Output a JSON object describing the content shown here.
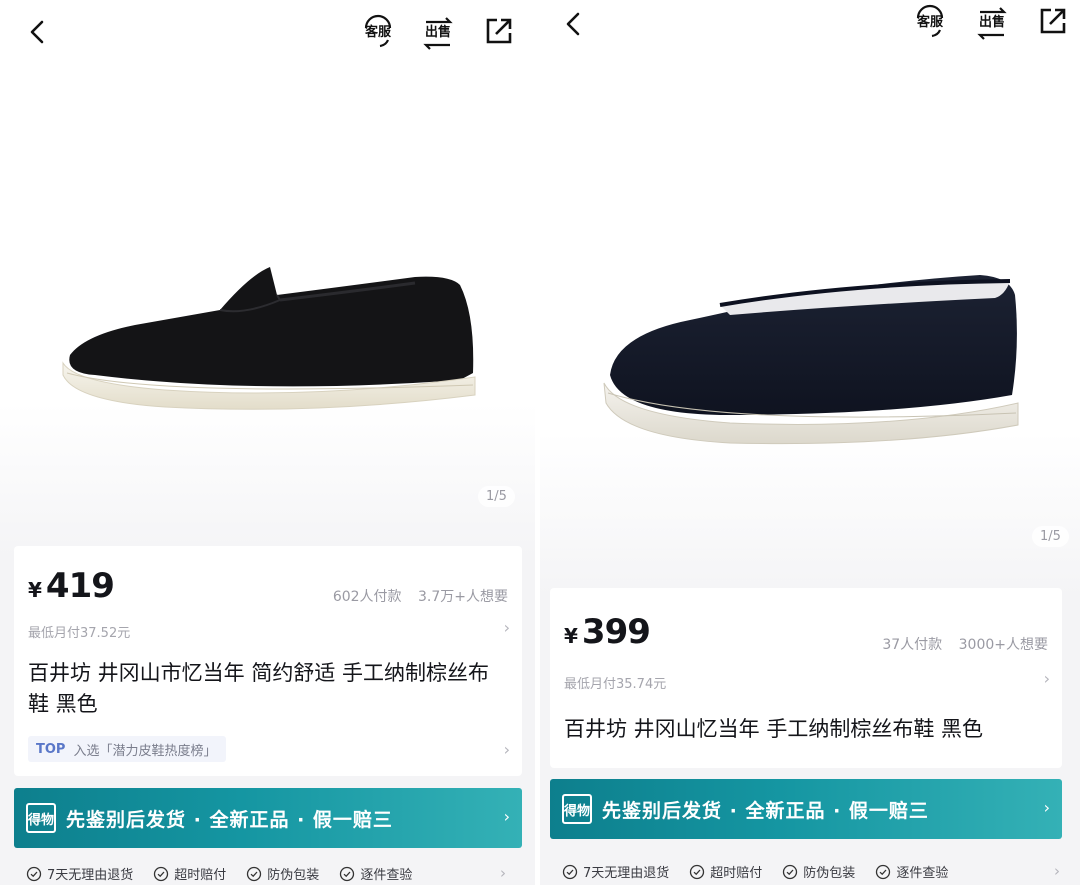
{
  "common": {
    "nav": {
      "service_label": "客服",
      "sell_label": "出售"
    },
    "icons": {
      "back": "chevron-left-icon",
      "service": "customer-service-icon",
      "sell": "sell-icon",
      "share": "share-icon",
      "check": "check-circle-icon",
      "arrow": "chevron-right-icon"
    },
    "banner_text": "先鉴别后发货 · 全新正品 · 假一赔三",
    "banner_logo": "得物",
    "currency": "¥",
    "guarantees": [
      "7天无理由退货",
      "超时赔付",
      "防伪包装",
      "逐件查验"
    ],
    "colors": {
      "banner_start": "#0d7f8d",
      "banner_end": "#34b1b6",
      "rank_accent": "#5a77c8"
    }
  },
  "left": {
    "pager": "1/5",
    "price": "419",
    "paid_count": "602人付款",
    "want_count": "3.7万+人想要",
    "monthly": "最低月付37.52元",
    "title": "百井坊 井冈山市忆当年 简约舒适 手工纳制棕丝布鞋 黑色",
    "rank_badge": "TOP",
    "rank_text": "入选「潜力皮鞋热度榜」"
  },
  "right": {
    "pager": "1/5",
    "price": "399",
    "paid_count": "37人付款",
    "want_count": "3000+人想要",
    "monthly": "最低月付35.74元",
    "title": "百井坊 井冈山忆当年 手工纳制棕丝布鞋 黑色"
  }
}
